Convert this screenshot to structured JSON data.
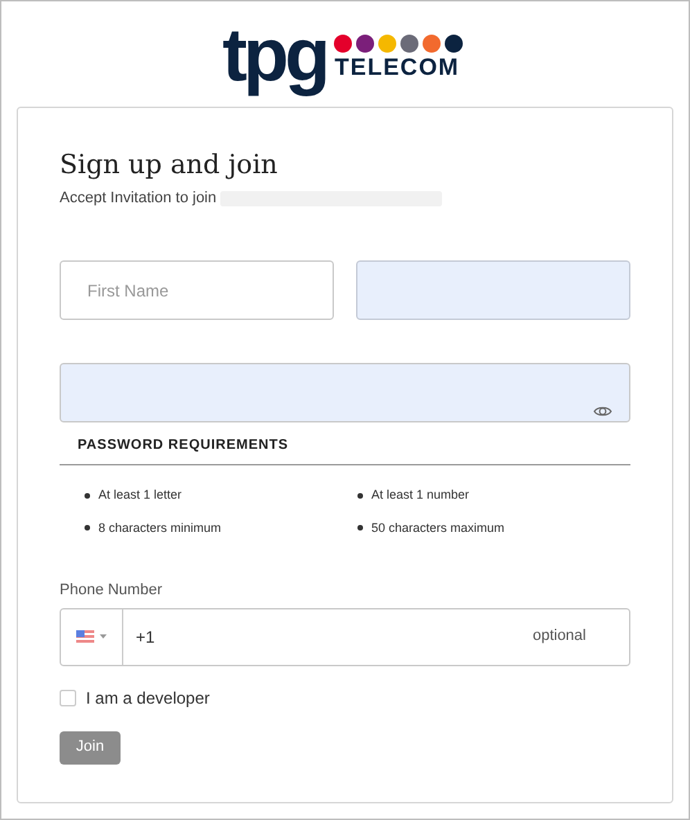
{
  "logo": {
    "wordmark": "tpg",
    "subtitle": "TELECOM",
    "dots": [
      {
        "color": "#e4002b"
      },
      {
        "color": "#7b1f7a"
      },
      {
        "color": "#f5b800"
      },
      {
        "color": "#6b6b78"
      },
      {
        "color": "#f26a2e"
      },
      {
        "color": "#0c2340"
      }
    ]
  },
  "title": "Sign up and join",
  "subtitle": "Accept Invitation to join",
  "name_fields": [
    {
      "placeholder": "First Name",
      "autofilled": false
    },
    {
      "autofilled": true
    }
  ],
  "password_field": {
    "autofilled": true
  },
  "requirements": {
    "heading": "PASSWORD REQUIREMENTS",
    "items": [
      "At least 1 letter",
      "At least 1 number",
      "8 characters minimum",
      "50 characters maximum"
    ]
  },
  "phone": {
    "label": "Phone Number",
    "value": "+1",
    "hint": "optional"
  },
  "developer_checkbox": {
    "label": "I am a developer",
    "checked": false
  },
  "join_button": {
    "label": "Join",
    "disabled": true
  }
}
